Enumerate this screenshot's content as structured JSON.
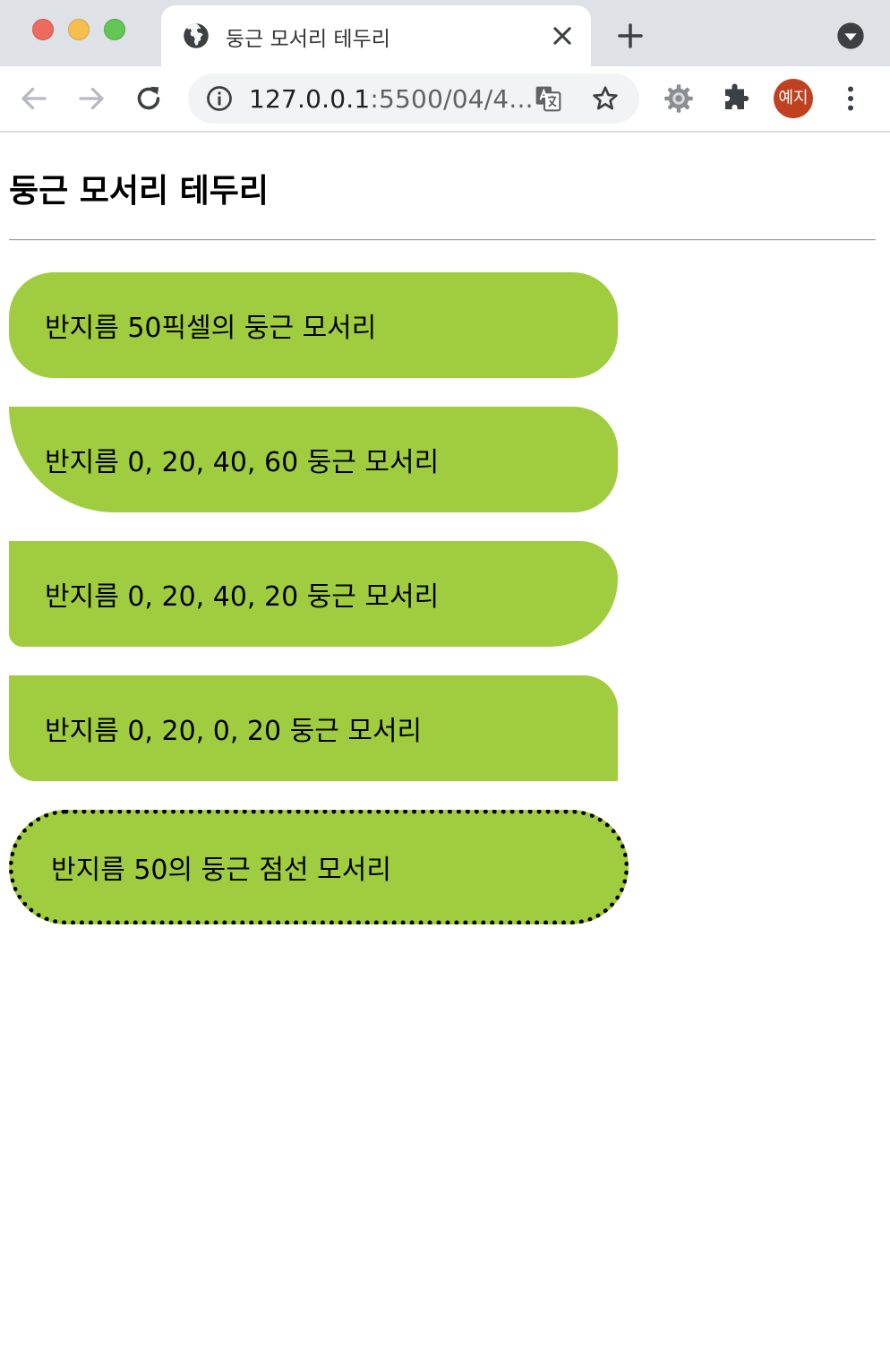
{
  "browser": {
    "tab": {
      "title": "둥근 모서리 테두리"
    },
    "address": {
      "host": "127.0.0.1",
      "rest": ":5500/04/4..."
    },
    "profile": {
      "label": "예지"
    },
    "colors": {
      "tabstrip": "#dee1e6",
      "omnibox": "#f1f3f4",
      "avatar": "#c0401f",
      "traffic_red": "#ed6a5e",
      "traffic_yellow": "#f5bf4f",
      "traffic_green": "#62c554"
    },
    "icons": [
      "globe-icon",
      "close-icon",
      "plus-icon",
      "tab-search-icon",
      "back-arrow-icon",
      "forward-arrow-icon",
      "reload-icon",
      "info-icon",
      "translate-icon",
      "star-icon",
      "gear-icon",
      "puzzle-icon",
      "more-vert-icon"
    ]
  },
  "page": {
    "heading": "둥근 모서리 테두리",
    "boxes": [
      {
        "label": "반지름 50픽셀의 둥근 모서리"
      },
      {
        "label": "반지름 0, 20, 40, 60 둥근 모서리"
      },
      {
        "label": "반지름 0, 20, 40, 20 둥근 모서리"
      },
      {
        "label": "반지름 0, 20, 0, 20 둥근 모서리"
      },
      {
        "label": "반지름 50의 둥근 점선 모서리"
      }
    ],
    "colors": {
      "box_fill": "#a0cd3f",
      "border": "#000000"
    }
  }
}
